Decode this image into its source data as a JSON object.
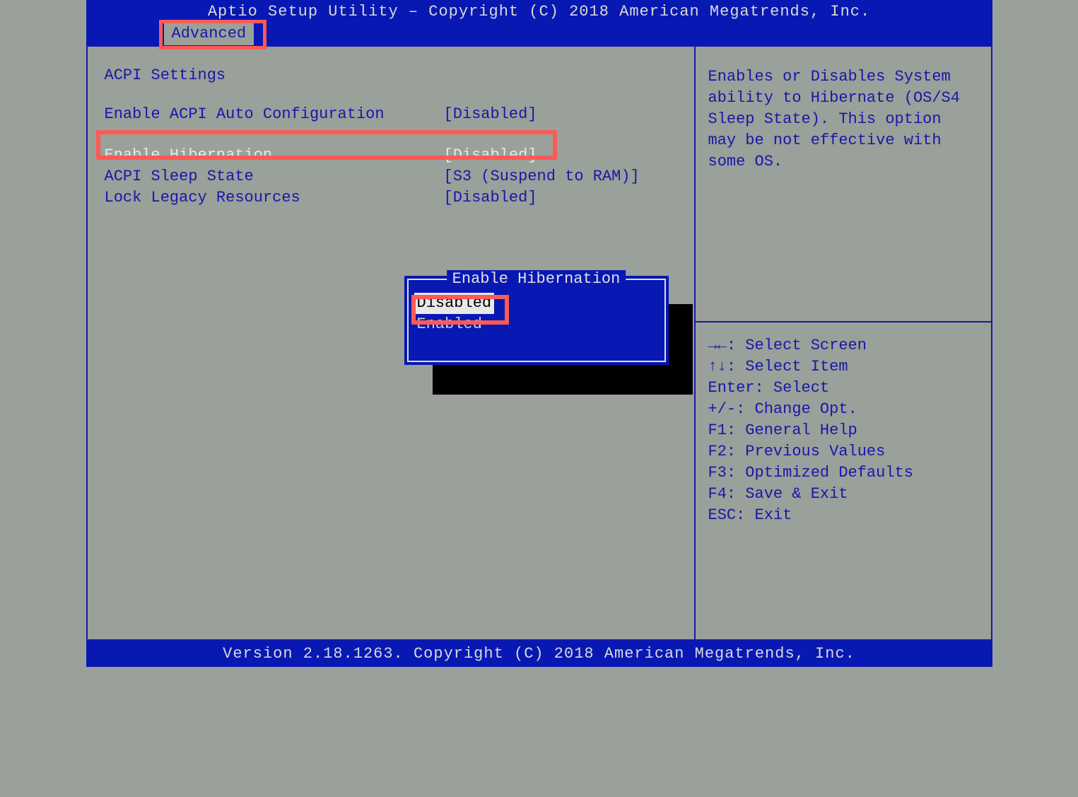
{
  "header": {
    "title": "Aptio Setup Utility – Copyright (C) 2018 American Megatrends, Inc.",
    "tab": "Advanced"
  },
  "section_title": "ACPI Settings",
  "settings": [
    {
      "label": "Enable ACPI Auto Configuration",
      "value": "[Disabled]",
      "selected": false
    },
    {
      "label": "Enable Hibernation",
      "value": "[Disabled]",
      "selected": true
    },
    {
      "label": "ACPI Sleep State",
      "value": "[S3 (Suspend to RAM)]",
      "selected": false
    },
    {
      "label": "Lock Legacy Resources",
      "value": "[Disabled]",
      "selected": false
    }
  ],
  "popup": {
    "title": "Enable Hibernation",
    "options": [
      {
        "label": "Disabled",
        "selected": true
      },
      {
        "label": "Enabled",
        "selected": false
      }
    ]
  },
  "help_text": "Enables or Disables System ability to Hibernate (OS/S4 Sleep State). This option may be not effective with some OS.",
  "key_help": [
    "→←: Select Screen",
    "↑↓: Select Item",
    "Enter: Select",
    "+/-: Change Opt.",
    "F1: General Help",
    "F2: Previous Values",
    "F3: Optimized Defaults",
    "F4: Save & Exit",
    "ESC: Exit"
  ],
  "footer": "Version 2.18.1263. Copyright (C) 2018 American Megatrends, Inc."
}
